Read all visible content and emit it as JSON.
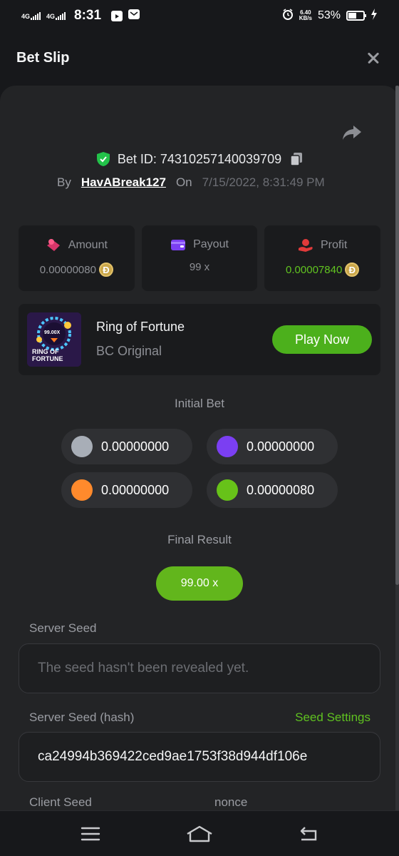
{
  "status_bar": {
    "network1": "4G",
    "network2": "4G",
    "time": "8:31",
    "speed_value": "6.40",
    "speed_unit": "KB/s",
    "battery": "53%",
    "battery_level": 0.53
  },
  "header": {
    "title": "Bet Slip"
  },
  "bet": {
    "id_label": "Bet ID: 74310257140039709",
    "by_label": "By",
    "user": "HavABreak127",
    "on_label": "On",
    "date": "7/15/2022, 8:31:49 PM"
  },
  "stats": {
    "amount_label": "Amount",
    "amount_value": "0.00000080",
    "payout_label": "Payout",
    "payout_value": "99 x",
    "profit_label": "Profit",
    "profit_value": "0.00007840",
    "coin_symbol": "Đ"
  },
  "game": {
    "name": "Ring of Fortune",
    "provider": "BC Original",
    "play_label": "Play Now",
    "thumb_multiplier": "99.00X",
    "thumb_title1": "RING OF",
    "thumb_title2": "FORTUNE"
  },
  "initial_bet": {
    "title": "Initial Bet",
    "chips": [
      {
        "color": "#a8aeb7",
        "value": "0.00000000"
      },
      {
        "color": "#7b3ff2",
        "value": "0.00000000"
      },
      {
        "color": "#ff8a2c",
        "value": "0.00000000"
      },
      {
        "color": "#67c219",
        "value": "0.00000080"
      }
    ]
  },
  "final_result": {
    "title": "Final Result",
    "value": "99.00 x"
  },
  "server_seed": {
    "label": "Server Seed",
    "placeholder": "The seed hasn't been revealed yet."
  },
  "server_seed_hash": {
    "label": "Server Seed (hash)",
    "settings_link": "Seed Settings",
    "value": "ca24994b369422ced9ae1753f38d944df106e"
  },
  "client_seed": {
    "label": "Client Seed",
    "nonce_label": "nonce"
  },
  "colors": {
    "accent_green": "#4cb01c",
    "profit_green": "#61c420",
    "verified_shield": "#23c24a"
  }
}
